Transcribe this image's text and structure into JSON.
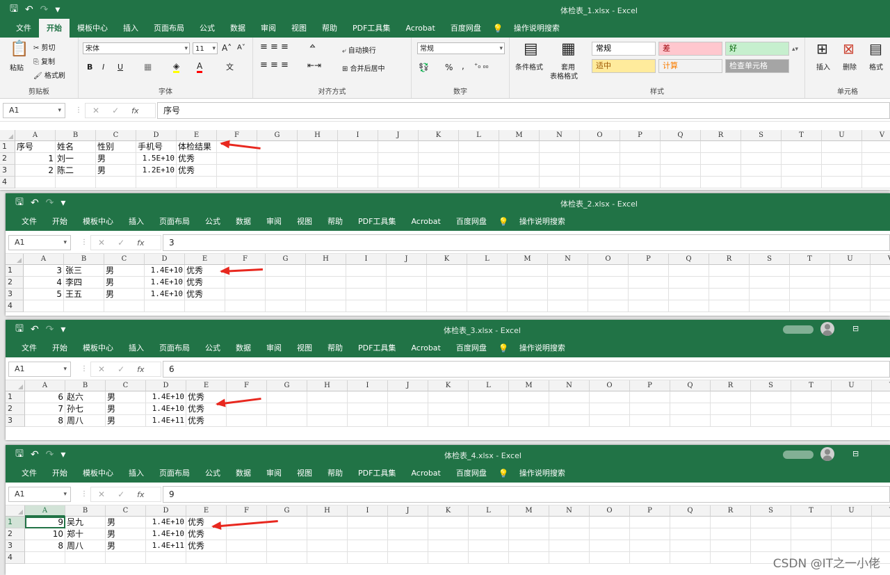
{
  "tabs": [
    "文件",
    "开始",
    "模板中心",
    "插入",
    "页面布局",
    "公式",
    "数据",
    "审阅",
    "视图",
    "帮助",
    "PDF工具集",
    "Acrobat",
    "百度网盘"
  ],
  "active_tab": "开始",
  "search_label": "操作说明搜索",
  "app_name": "Excel",
  "title_sep": "-",
  "columns": [
    "A",
    "B",
    "C",
    "D",
    "E",
    "F",
    "G",
    "H",
    "I",
    "J",
    "K",
    "L",
    "M",
    "N",
    "O",
    "P",
    "Q",
    "R",
    "S",
    "T",
    "U",
    "V"
  ],
  "ribbon": {
    "clipboard": {
      "paste": "粘贴",
      "cut": "剪切",
      "copy": "复制",
      "format_painter": "格式刷",
      "label": "剪贴板"
    },
    "font": {
      "name": "宋体",
      "size": "11",
      "bold": "B",
      "italic": "I",
      "underline": "U",
      "grow": "A",
      "shrink": "A",
      "label": "字体",
      "fill_color": "#ffff00",
      "font_color": "#ff0000"
    },
    "alignment": {
      "wrap": "自动换行",
      "merge": "合并后居中",
      "label": "对齐方式"
    },
    "number": {
      "format": "常规",
      "percent": "%",
      "comma": ",",
      "label": "数字"
    },
    "styles": {
      "conditional": "条件格式",
      "table_l1": "套用",
      "table_l2": "表格格式",
      "label": "样式",
      "cells": [
        {
          "text": "常规",
          "bg": "#ffffff",
          "fg": "#000000"
        },
        {
          "text": "差",
          "bg": "#ffc7ce",
          "fg": "#9c0006"
        },
        {
          "text": "好",
          "bg": "#c6efce",
          "fg": "#006100"
        },
        {
          "text": "适中",
          "bg": "#ffeb9c",
          "fg": "#9c5700"
        },
        {
          "text": "计算",
          "bg": "#f2f2f2",
          "fg": "#fa7d00"
        },
        {
          "text": "检查单元格",
          "bg": "#a5a5a5",
          "fg": "#ffffff"
        }
      ]
    },
    "cells_group": {
      "insert": "插入",
      "delete": "删除",
      "format": "格式",
      "label": "单元格"
    }
  },
  "windows": [
    {
      "title": "体检表_1.xlsx",
      "namebox": "A1",
      "formula": "序号",
      "rows": [
        "1",
        "2",
        "3",
        "4"
      ],
      "data": [
        [
          "序号",
          "姓名",
          "性别",
          "手机号",
          "体检结果"
        ],
        [
          "1",
          "刘一",
          "男",
          "1.5E+10",
          "优秀"
        ],
        [
          "2",
          "陈二",
          "男",
          "1.2E+10",
          "优秀"
        ]
      ]
    },
    {
      "title": "体检表_2.xlsx",
      "namebox": "A1",
      "formula": "3",
      "rows": [
        "1",
        "2",
        "3",
        "4"
      ],
      "data": [
        [
          "3",
          "张三",
          "男",
          "1.4E+10",
          "优秀"
        ],
        [
          "4",
          "李四",
          "男",
          "1.4E+10",
          "优秀"
        ],
        [
          "5",
          "王五",
          "男",
          "1.4E+10",
          "优秀"
        ]
      ]
    },
    {
      "title": "体检表_3.xlsx",
      "namebox": "A1",
      "formula": "6",
      "rows": [
        "1",
        "2",
        "3"
      ],
      "data": [
        [
          "6",
          "赵六",
          "男",
          "1.4E+10",
          "优秀"
        ],
        [
          "7",
          "孙七",
          "男",
          "1.4E+10",
          "优秀"
        ],
        [
          "8",
          "周八",
          "男",
          "1.4E+11",
          "优秀"
        ]
      ]
    },
    {
      "title": "体检表_4.xlsx",
      "namebox": "A1",
      "formula": "9",
      "rows": [
        "1",
        "2",
        "3",
        "4"
      ],
      "data": [
        [
          "9",
          "吴九",
          "男",
          "1.4E+10",
          "优秀"
        ],
        [
          "10",
          "郑十",
          "男",
          "1.4E+10",
          "优秀"
        ],
        [
          "8",
          "周八",
          "男",
          "1.4E+11",
          "优秀"
        ]
      ]
    }
  ],
  "watermark": "CSDN @IT之一小佬",
  "colors": {
    "excel_green": "#217346",
    "arrow": "#e8281f"
  }
}
